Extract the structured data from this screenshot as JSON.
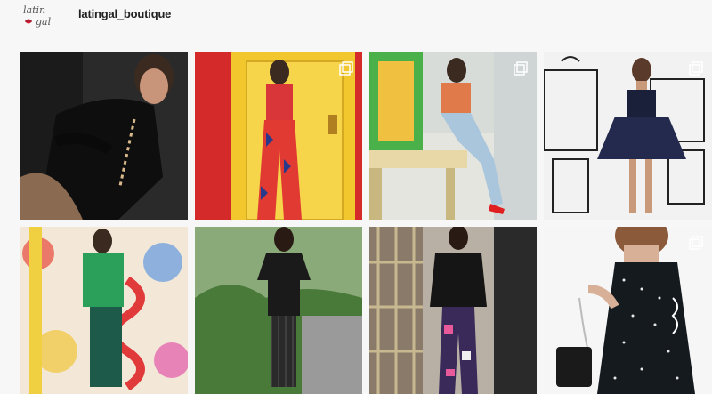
{
  "profile": {
    "username": "latingal_boutique",
    "logo_icon": "latingal-script-logo-with-lips-icon"
  },
  "posts": [
    {
      "name": "post-black-cutout-dress",
      "carousel": false
    },
    {
      "name": "post-red-printed-set",
      "carousel": true
    },
    {
      "name": "post-floral-top-jeans",
      "carousel": true
    },
    {
      "name": "post-navy-tulle-dress",
      "carousel": true
    },
    {
      "name": "post-green-sweater-art-wall",
      "carousel": false
    },
    {
      "name": "post-black-dress-garden",
      "carousel": false
    },
    {
      "name": "post-leather-jacket-print-pants",
      "carousel": false
    },
    {
      "name": "post-tweed-dress-chain-bag",
      "carousel": true
    }
  ],
  "colors": {
    "accent": "#e0323c",
    "text": "#222222",
    "background": "#f7f7f7"
  }
}
